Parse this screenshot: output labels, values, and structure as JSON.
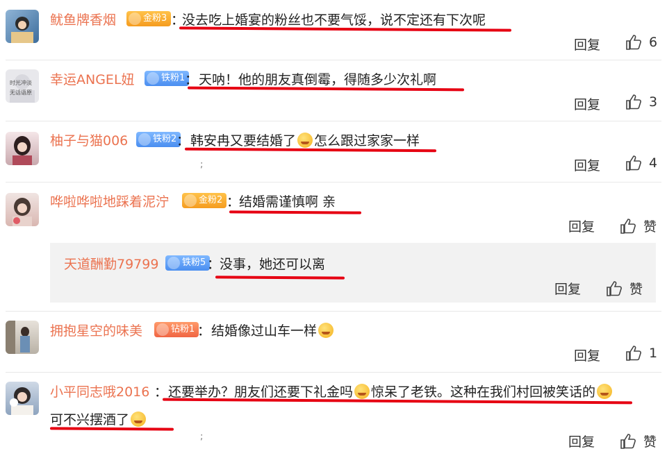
{
  "comments": [
    {
      "user": "鱿鱼牌香烟",
      "badge": "金粉3",
      "text": "没去吃上婚宴的粉丝也不要气馁，说不定还有下次呢",
      "reply": "回复",
      "likes": "6"
    },
    {
      "user": "幸运ANGEL妞",
      "badge": "铁粉1",
      "text": "天呐！他的朋友真倒霉，得随多少次礼啊",
      "reply": "回复",
      "likes": "3"
    },
    {
      "user": "柚子与猫006",
      "badge": "铁粉2",
      "text_a": "韩安冉又要结婚了",
      "text_b": "怎么跟过家家一样",
      "reply": "回复",
      "likes": "4"
    },
    {
      "user": "哗啦哗啦地踩着泥泞",
      "badge": "金粉2",
      "text": "结婚需谨慎啊 亲",
      "reply": "回复",
      "likes": "赞"
    },
    {
      "user": "天道酬勤79799",
      "badge": "铁粉5",
      "text": "没事，她还可以离",
      "reply": "回复",
      "likes": "赞"
    },
    {
      "user": "拥抱星空的味美",
      "badge": "钻粉1",
      "text": "结婚像过山车一样",
      "reply": "回复",
      "likes": "1"
    },
    {
      "user": "小平同志哦2016",
      "text_a": "还要举办？朋友们还要下礼金吗",
      "text_b": "惊呆了老铁。这种在我们村回被笑话的",
      "text_c": "可不兴摆酒了",
      "reply": "回复",
      "likes": "赞"
    }
  ],
  "avatar_labels": {
    "c2": "时光冲淡\n无话语原"
  },
  "colors": {
    "username": "#eb7350",
    "underline": "#e60012",
    "gold_badge": "#f5a623",
    "iron_badge": "#4a8ef0",
    "drill_badge": "#f06543"
  }
}
